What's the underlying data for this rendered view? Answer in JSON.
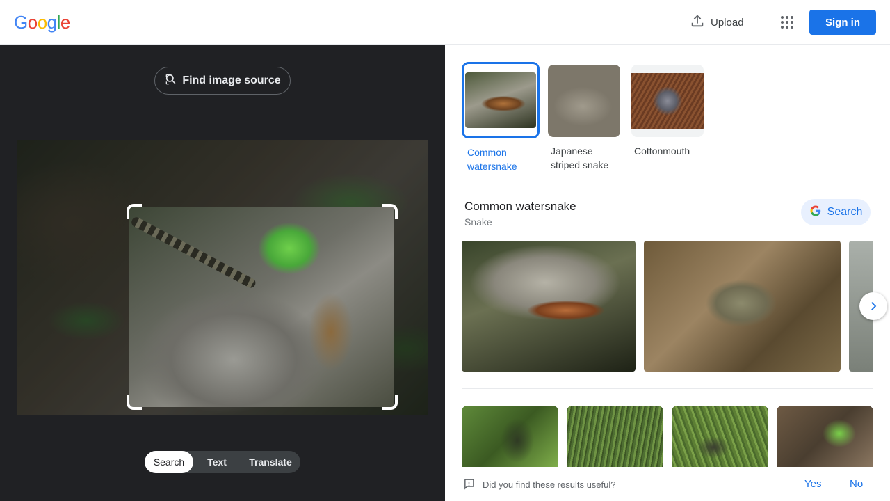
{
  "header": {
    "logo_letters": [
      {
        "ch": "G",
        "color": "#4285F4"
      },
      {
        "ch": "o",
        "color": "#EA4335"
      },
      {
        "ch": "o",
        "color": "#FBBC05"
      },
      {
        "ch": "g",
        "color": "#4285F4"
      },
      {
        "ch": "l",
        "color": "#34A853"
      },
      {
        "ch": "e",
        "color": "#EA4335"
      }
    ],
    "upload_label": "Upload",
    "upload_icon": "upload-icon",
    "apps_icon": "apps-grid-icon",
    "signin_label": "Sign in",
    "accent": "#1a73e8"
  },
  "lens": {
    "find_source_label": "Find image source",
    "find_source_icon": "image-search-icon",
    "modes": [
      {
        "label": "Search",
        "active": true
      },
      {
        "label": "Text",
        "active": false
      },
      {
        "label": "Translate",
        "active": false
      }
    ]
  },
  "results": {
    "candidates": [
      {
        "label": "Common watersnake",
        "selected": true
      },
      {
        "label": "Japanese striped snake",
        "selected": false
      },
      {
        "label": "Cottonmouth",
        "selected": false
      }
    ],
    "knowledge": {
      "title": "Common watersnake",
      "subtitle": "Snake",
      "search_label": "Search"
    },
    "feedback": {
      "question": "Did you find these results useful?",
      "yes": "Yes",
      "no": "No",
      "icon": "feedback-icon"
    }
  }
}
